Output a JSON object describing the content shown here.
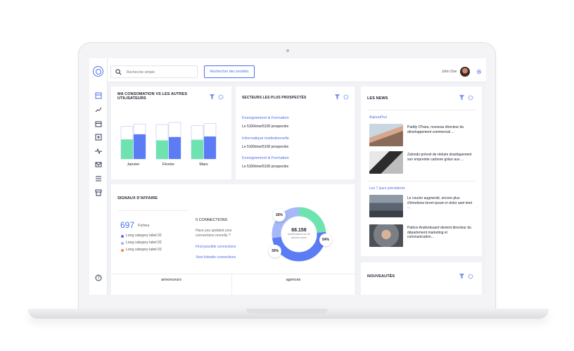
{
  "topbar": {
    "search_placeholder": "Recherche simple",
    "search_button": "Rechercher des sociétés",
    "user_name": "John Doe"
  },
  "consumption": {
    "title_line1": "MA CONSOMATION VS LES AUTRES",
    "title_line2": "UTILISATEURS",
    "chart_data": {
      "type": "bar",
      "categories": [
        "Janvier",
        "Février",
        "Mars"
      ],
      "series": [
        {
          "values": [
            0.63,
            0.6,
            0.62
          ],
          "color": "#6ee3b0"
        },
        {
          "values": [
            0.9,
            0.8,
            0.82
          ],
          "color": "#5b7cf5"
        }
      ],
      "outline_values": [
        0.95,
        1.0,
        0.97
      ]
    }
  },
  "sectors": {
    "title": "SECTEURS LES PLUS PROSPECTÉS",
    "items": [
      {
        "name": "Enseignement & Formation",
        "detail": "Le 5100ème/5100 prospectés"
      },
      {
        "name": "Informatique institutionnelle",
        "detail": "Le 5100ème/5100 prospectés"
      },
      {
        "name": "Enseignement & Formation",
        "detail": "Le 5100ème/5100 prospectés"
      }
    ]
  },
  "signals": {
    "title": "SIGNAUX D'AFFAIRE",
    "count": "697",
    "count_label": "Fiches",
    "legend": [
      {
        "label": "Long category label 02",
        "color": "#4f6fea"
      },
      {
        "label": "Long category label 02",
        "color": "#9fb2f7"
      },
      {
        "label": "Long category label 03",
        "color": "#f08a3c"
      }
    ],
    "connections_title": "0 CONNECTIONS",
    "connections_question": "Have you updated your connections recently ?",
    "link_find": "Find possible connections",
    "link_linkedin": "View linkedin connections",
    "donut": {
      "center_value": "68.158",
      "center_label": "Modifications les 30 derniers jours",
      "segments": [
        {
          "label": "54%",
          "value": 54,
          "color": "#5b7cf5"
        },
        {
          "label": "30%",
          "value": 30,
          "color": "#a6b8f8"
        },
        {
          "label": "26%",
          "value": 26,
          "color": "#6ee3b0"
        }
      ]
    },
    "bottom_tabs": [
      "annonceurs",
      "agences"
    ]
  },
  "news": {
    "title": "LES NEWS",
    "section_today": "Aujourd'hui",
    "section_week": "Les 7 jours précédents",
    "items": [
      {
        "text": "Paddy O'hara, nouveau directeur du développement commercial ..."
      },
      {
        "text": "Zalondo prévoit de réduire drastiquement son empreinte carbone grâce aux ..."
      },
      {
        "text": "Le courier augmenté, encore plus d'émotions lorem ipsum in dolor aset imet ..."
      },
      {
        "text": "Patrice Anderdouard devient directeur du département marketing et communication..."
      }
    ]
  },
  "novelties": {
    "title": "NOUVEAUTÉS"
  },
  "colors": {
    "accent": "#4f6fea",
    "green": "#6ee3b0",
    "light_blue": "#a6b8f8",
    "orange": "#f08a3c"
  }
}
